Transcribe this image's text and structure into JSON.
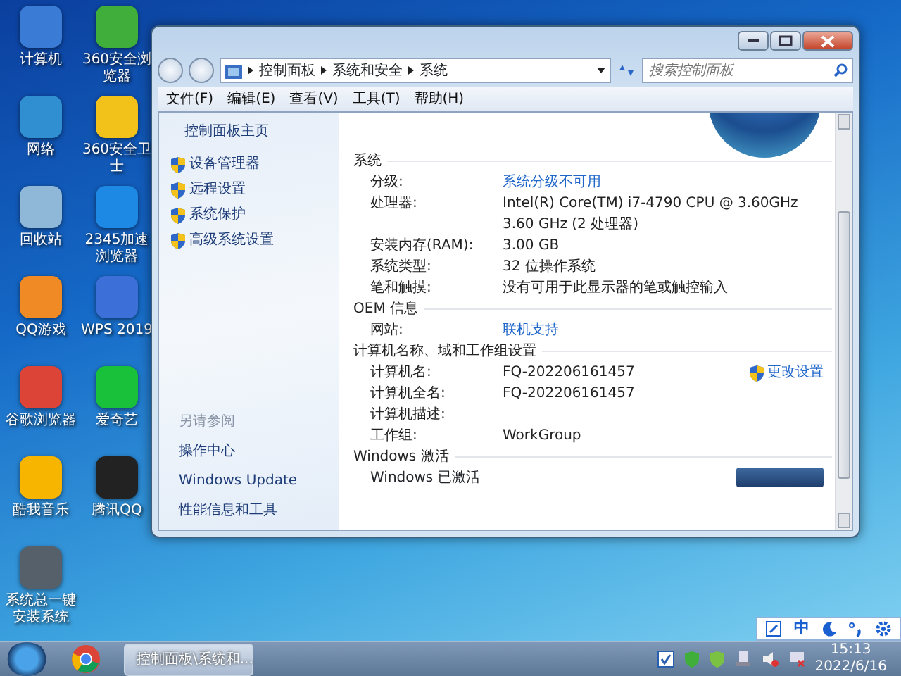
{
  "desktop_icons": [
    {
      "label": "计算机",
      "color": "#3a7bd5"
    },
    {
      "label": "360安全浏览器",
      "color": "#3fae3a"
    },
    {
      "label": "网络",
      "color": "#2f8fd0"
    },
    {
      "label": "360安全卫士",
      "color": "#f2c21b"
    },
    {
      "label": "回收站",
      "color": "#8fb8d8"
    },
    {
      "label": "2345加速浏览器",
      "color": "#1e88e5"
    },
    {
      "label": "QQ游戏",
      "color": "#f08a24"
    },
    {
      "label": "WPS 2019",
      "color": "#3d6fd8"
    },
    {
      "label": "谷歌浏览器",
      "color": "#db4437"
    },
    {
      "label": "爱奇艺",
      "color": "#19c13a"
    },
    {
      "label": "酷我音乐",
      "color": "#f7b500"
    },
    {
      "label": "腾讯QQ",
      "color": "#222222"
    },
    {
      "label": "系统总一键安装系统",
      "color": "#55606a"
    }
  ],
  "window": {
    "breadcrumb": [
      "控制面板",
      "系统和安全",
      "系统"
    ],
    "search": {
      "placeholder": "搜索控制面板"
    },
    "menu": [
      "文件(F)",
      "编辑(E)",
      "查看(V)",
      "工具(T)",
      "帮助(H)"
    ],
    "sidebar": {
      "home": "控制面板主页",
      "tasks": [
        {
          "label": "设备管理器"
        },
        {
          "label": "远程设置"
        },
        {
          "label": "系统保护"
        },
        {
          "label": "高级系统设置"
        }
      ],
      "see_also_title": "另请参阅",
      "see_also": [
        "操作中心",
        "Windows Update",
        "性能信息和工具"
      ]
    },
    "sections": [
      {
        "title": "系统",
        "rows": [
          {
            "label": "分级:",
            "value": "系统分级不可用",
            "kind": "link"
          },
          {
            "label": "处理器:",
            "value": "Intel(R) Core(TM) i7-4790 CPU @ 3.60GHz   3.60 GHz  (2 处理器)",
            "kind": "text"
          },
          {
            "label": "安装内存(RAM):",
            "value": "3.00 GB",
            "kind": "text"
          },
          {
            "label": "系统类型:",
            "value": "32 位操作系统",
            "kind": "text"
          },
          {
            "label": "笔和触摸:",
            "value": "没有可用于此显示器的笔或触控输入",
            "kind": "text"
          }
        ]
      },
      {
        "title": "OEM 信息",
        "rows": [
          {
            "label": "网站:",
            "value": "联机支持",
            "kind": "link"
          }
        ]
      },
      {
        "title": "计算机名称、域和工作组设置",
        "rows": [
          {
            "label": "计算机名:",
            "value": "FQ-202206161457",
            "kind": "text",
            "action": "更改设置"
          },
          {
            "label": "计算机全名:",
            "value": "FQ-202206161457",
            "kind": "text"
          },
          {
            "label": "计算机描述:",
            "kind": "text"
          },
          {
            "label": "工作组:",
            "value": "WorkGroup",
            "kind": "text"
          }
        ]
      },
      {
        "title": "Windows 激活",
        "rows": [
          {
            "label": "Windows 已激活",
            "kind": "badge"
          }
        ]
      }
    ]
  },
  "taskbar": {
    "task": {
      "label": "控制面板\\系统和...",
      "selected": true
    },
    "time": "15:13",
    "date": "2022/6/16"
  },
  "ime_bar": {
    "label": "中"
  }
}
